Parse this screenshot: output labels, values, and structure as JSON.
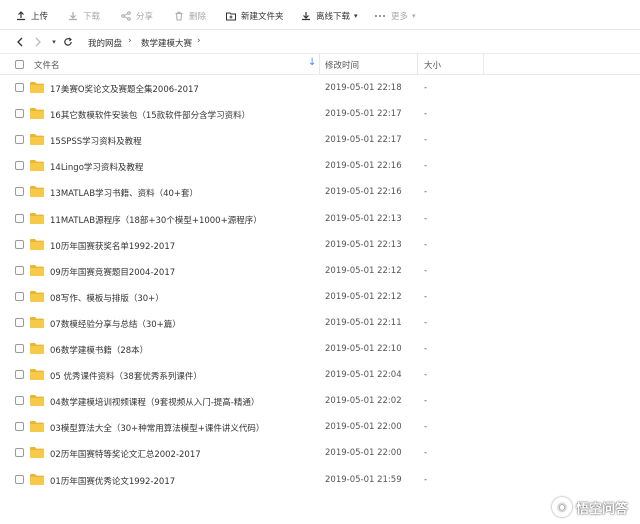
{
  "toolbar": {
    "upload": "上传",
    "download": "下载",
    "share": "分享",
    "delete": "删除",
    "new_folder": "新建文件夹",
    "offline_download": "离线下载",
    "more": "更多"
  },
  "nav": {
    "root": "我的网盘",
    "current": "数学建模大赛"
  },
  "table": {
    "headers": {
      "name": "文件名",
      "modified": "修改时间",
      "size": "大小"
    },
    "rows": [
      {
        "name": "17美赛O奖论文及赛题全集2006-2017",
        "modified": "2019-05-01 22:18",
        "size": "-"
      },
      {
        "name": "16其它数模软件安装包（15款软件部分含学习资料）",
        "modified": "2019-05-01 22:17",
        "size": "-"
      },
      {
        "name": "15SPSS学习资料及教程",
        "modified": "2019-05-01 22:17",
        "size": "-"
      },
      {
        "name": "14Lingo学习资料及教程",
        "modified": "2019-05-01 22:16",
        "size": "-"
      },
      {
        "name": "13MATLAB学习书籍、资料（40+套）",
        "modified": "2019-05-01 22:16",
        "size": "-"
      },
      {
        "name": "11MATLAB源程序（18部+30个模型+1000+源程序）",
        "modified": "2019-05-01 22:13",
        "size": "-"
      },
      {
        "name": "10历年国赛获奖名单1992-2017",
        "modified": "2019-05-01 22:13",
        "size": "-"
      },
      {
        "name": "09历年国赛竞赛题目2004-2017",
        "modified": "2019-05-01 22:12",
        "size": "-"
      },
      {
        "name": "08写作、模板与排版（30+）",
        "modified": "2019-05-01 22:12",
        "size": "-"
      },
      {
        "name": "07数模经验分享与总结（30+篇）",
        "modified": "2019-05-01 22:11",
        "size": "-"
      },
      {
        "name": "06数学建模书籍（28本）",
        "modified": "2019-05-01 22:10",
        "size": "-"
      },
      {
        "name": "05 优秀课件资料（38套优秀系列课件）",
        "modified": "2019-05-01 22:04",
        "size": "-"
      },
      {
        "name": "04数学建模培训视频课程（9套视频从入门-提高-精通）",
        "modified": "2019-05-01 22:02",
        "size": "-"
      },
      {
        "name": "03模型算法大全（30+种常用算法模型+课件讲义代码）",
        "modified": "2019-05-01 22:00",
        "size": "-"
      },
      {
        "name": "02历年国赛特等奖论文汇总2002-2017",
        "modified": "2019-05-01 22:00",
        "size": "-"
      },
      {
        "name": "01历年国赛优秀论文1992-2017",
        "modified": "2019-05-01 21:59",
        "size": "-"
      }
    ]
  },
  "watermark": {
    "text": "悟空问答"
  },
  "colors": {
    "folder": "#f7c948",
    "folder_dark": "#eab52f",
    "accent": "#3b8cff"
  }
}
